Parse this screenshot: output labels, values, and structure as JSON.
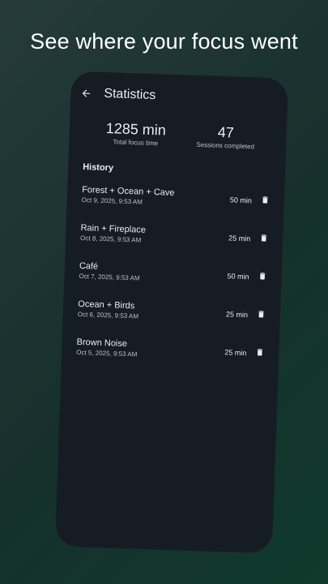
{
  "headline": "See where your focus went",
  "appbar": {
    "title": "Statistics"
  },
  "stats": {
    "total_focus": {
      "value": "1285 min",
      "label": "Total focus time"
    },
    "sessions": {
      "value": "47",
      "label": "Sessions completed"
    }
  },
  "history": {
    "title": "History",
    "items": [
      {
        "name": "Forest + Ocean + Cave",
        "date": "Oct 9, 2025, 9:53 AM",
        "duration": "50 min"
      },
      {
        "name": "Rain + Fireplace",
        "date": "Oct 8, 2025, 9:53 AM",
        "duration": "25 min"
      },
      {
        "name": "Café",
        "date": "Oct 7, 2025, 9:53 AM",
        "duration": "50 min"
      },
      {
        "name": "Ocean + Birds",
        "date": "Oct 6, 2025, 9:53 AM",
        "duration": "25 min"
      },
      {
        "name": "Brown Noise",
        "date": "Oct 5, 2025, 9:53 AM",
        "duration": "25 min"
      }
    ]
  },
  "icons": {
    "back": "arrow-back-icon",
    "delete": "trash-icon"
  },
  "colors": {
    "screen": "#161c24",
    "text": "#e9edf2",
    "muted": "#b8c0ca"
  }
}
